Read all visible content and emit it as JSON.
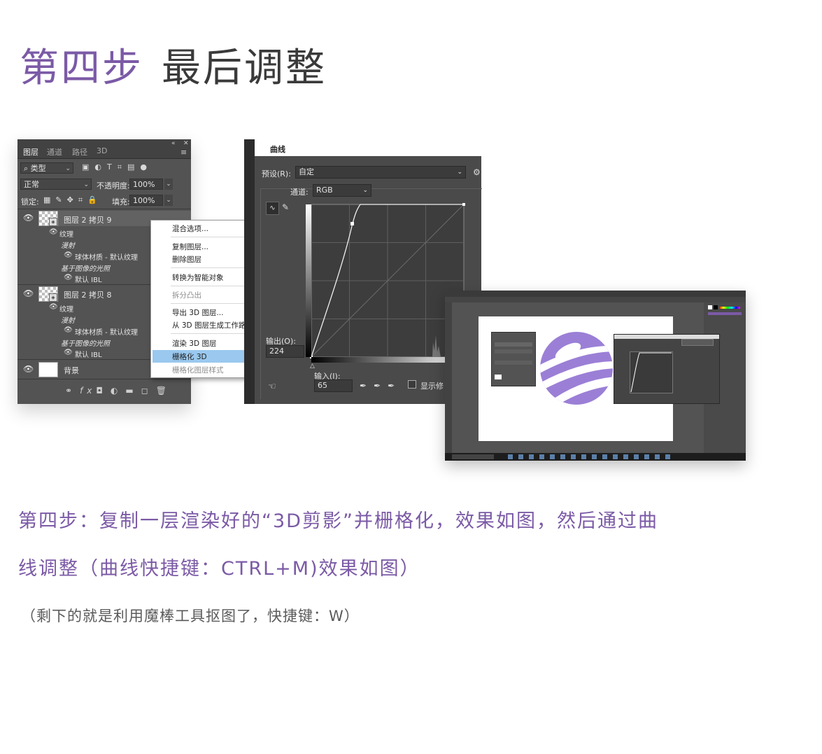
{
  "heading": {
    "step": "第四步",
    "title": "最后调整"
  },
  "description": {
    "line1": "第四步：复制一层渲染好的“3D剪影”并栅格化，效果如图，然后通过曲",
    "line2": "线调整（曲线快捷键：CTRL+M)效果如图）"
  },
  "note": "（剩下的就是利用魔棒工具抠图了，快捷键：W）",
  "layers_panel": {
    "tabs": [
      "图层",
      "通道",
      "路径",
      "3D"
    ],
    "filter_label": "类型",
    "blend_mode": "正常",
    "opacity_label": "不透明度:",
    "opacity_value": "100%",
    "lock_label": "锁定:",
    "fill_label": "填充:",
    "fill_value": "100%",
    "layer1": {
      "name": "图层 2 拷贝 9",
      "texture": "纹理",
      "diffuse": "漫射",
      "material": "球体材质 - 默认纹理",
      "lighting": "基于图像的光照",
      "ibl": "默认 IBL"
    },
    "layer2": {
      "name": "图层 2 拷贝 8",
      "texture": "纹理",
      "diffuse": "漫射",
      "material": "球体材质 - 默认纹理",
      "lighting": "基于图像的光照",
      "ibl": "默认 IBL"
    },
    "background": "背景",
    "footer_fx": "fx"
  },
  "context_menu": {
    "items": [
      "混合选项...",
      "复制图层...",
      "删除图层",
      "转换为智能对象",
      "拆分凸出",
      "导出 3D 图层...",
      "从 3D 图层生成工作路径",
      "渲染 3D 图层",
      "栅格化 3D",
      "栅格化图层样式"
    ],
    "highlighted": "栅格化 3D"
  },
  "curves": {
    "title": "曲线",
    "preset_label": "预设(R):",
    "preset_value": "自定",
    "channel_label": "通道:",
    "channel_value": "RGB",
    "output_label": "输出(O):",
    "output_value": "224",
    "input_label": "输入(I):",
    "input_value": "65",
    "show_clip": "显示修"
  },
  "colors": {
    "accent": "#7b5aa6",
    "title_gray": "#3a3a3a",
    "ps_panel": "#535353",
    "highlight": "#9ac8ef"
  }
}
